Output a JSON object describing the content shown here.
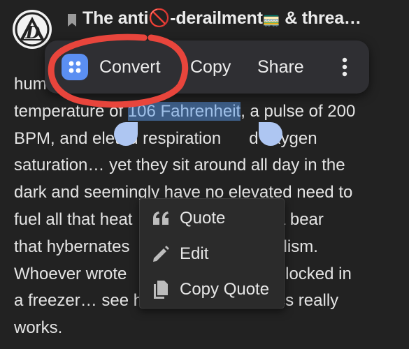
{
  "header": {
    "title_parts": [
      "The anti",
      "🚫",
      "-derailment",
      "🚃",
      " & threa…"
    ]
  },
  "selection_toolbar": {
    "convert_label": "Convert",
    "copy_label": "Copy",
    "share_label": "Share"
  },
  "post": {
    "lines": [
      {
        "before": "hum",
        "selected": "",
        "after": ""
      },
      {
        "before": "temperature of ",
        "selected": "106 Fahrenheit",
        "after": ", a pulse of 200"
      },
      {
        "before": "BPM, and ele",
        "selected": "",
        "after": "ted respiration      d oxygen"
      },
      {
        "before": "saturation… yet they sit around all day in the",
        "selected": "",
        "after": ""
      },
      {
        "before": "dark and seemingly have no elevated need to",
        "selected": "",
        "after": ""
      },
      {
        "before": "fuel all that heat",
        "selected": "",
        "after": "                         ine a bear"
      },
      {
        "before": "that hybernates",
        "selected": "",
        "after": "                           abolism."
      },
      {
        "before": "Whoever wrote",
        "selected": "",
        "after": "                            get locked in"
      },
      {
        "before": "a freezer… see h",
        "selected": "",
        "after": "                            ics really"
      },
      {
        "before": "works.",
        "selected": "",
        "after": ""
      }
    ]
  },
  "quote_menu": {
    "quote_label": "Quote",
    "edit_label": "Edit",
    "copy_quote_label": "Copy Quote"
  },
  "colors": {
    "background": "#222222",
    "selection_highlight": "#3d5d86",
    "handle": "#aec6f2",
    "annotation": "#e8453c",
    "convert_icon": "#5b8ff2"
  }
}
